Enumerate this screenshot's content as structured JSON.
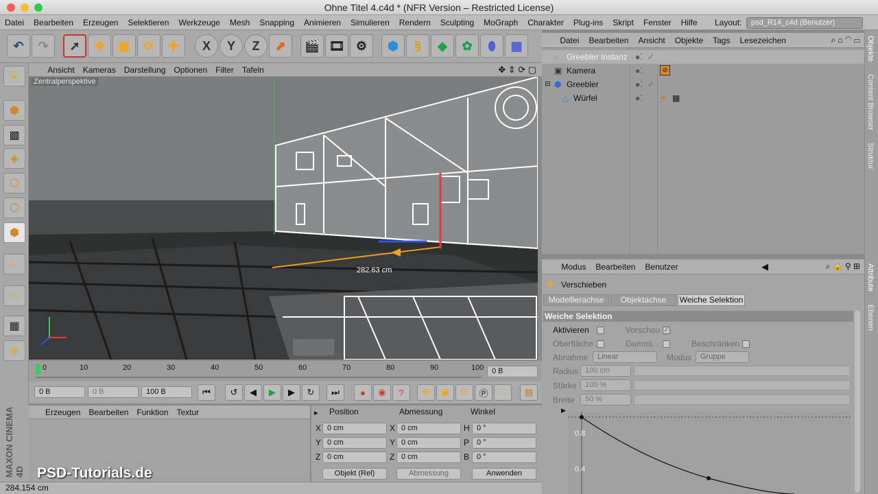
{
  "window": {
    "title": "Ohne Titel 4.c4d * (NFR Version – Restricted License)"
  },
  "menubar": {
    "items": [
      "Datei",
      "Bearbeiten",
      "Erzeugen",
      "Selektieren",
      "Werkzeuge",
      "Mesh",
      "Snapping",
      "Animieren",
      "Simulieren",
      "Rendern",
      "Sculpting",
      "MoGraph",
      "Charakter",
      "Plug-ins",
      "Skript",
      "Fenster",
      "Hilfe"
    ],
    "layout_label": "Layout:",
    "layout_value": "psd_R14_c4d (Benutzer)"
  },
  "viewport": {
    "menu": [
      "Ansicht",
      "Kameras",
      "Darstellung",
      "Optionen",
      "Filter",
      "Tafeln"
    ],
    "label": "Zentralperspektive",
    "measure": "282.63 cm"
  },
  "timeline": {
    "ticks": [
      "0",
      "10",
      "20",
      "30",
      "40",
      "50",
      "60",
      "70",
      "80",
      "90",
      "100"
    ],
    "current_frame": "0 B"
  },
  "transport": {
    "start": "0 B",
    "preview_start": "0 B",
    "end": "100 B"
  },
  "materials": {
    "menu": [
      "Erzeugen",
      "Bearbeiten",
      "Funktion",
      "Textur"
    ]
  },
  "coordinates": {
    "headers": [
      "Position",
      "Abmessung",
      "Winkel"
    ],
    "rows": [
      {
        "a": "X",
        "pos": "0 cm",
        "b": "X",
        "size": "0 cm",
        "c": "H",
        "rot": "0 °"
      },
      {
        "a": "Y",
        "pos": "0 cm",
        "b": "Y",
        "size": "0 cm",
        "c": "P",
        "rot": "0 °"
      },
      {
        "a": "Z",
        "pos": "0 cm",
        "b": "Z",
        "size": "0 cm",
        "c": "B",
        "rot": "0 °"
      }
    ],
    "mode": "Objekt (Rel)",
    "size_mode": "Abmessung",
    "apply": "Anwenden"
  },
  "status": {
    "text": "284.154 cm"
  },
  "watermark": {
    "text": "PSD-Tutorials.de",
    "brand": "MAXON CINEMA 4D"
  },
  "object_manager": {
    "menu": [
      "Datei",
      "Bearbeiten",
      "Ansicht",
      "Objekte",
      "Tags",
      "Lesezeichen"
    ],
    "objects": [
      {
        "name": "Greebler Instanz",
        "highlight": true
      },
      {
        "name": "Kamera",
        "highlight": false
      },
      {
        "name": "Greebler",
        "highlight": false
      },
      {
        "name": "Würfel",
        "highlight": false
      }
    ]
  },
  "attributes": {
    "menu": [
      "Modus",
      "Bearbeiten",
      "Benutzer"
    ],
    "tool": "Verschieben",
    "tabs": [
      "Modellierachse",
      "Objektachse",
      "Weiche Selektion"
    ],
    "section": "Weiche Selektion",
    "activate": "Aktivieren",
    "preview": "Vorschau",
    "surface": "Oberfläche",
    "rubber": "Gummi. .",
    "restrict": "Beschränken",
    "falloff_label": "Abnahme",
    "falloff_value": "Linear",
    "mode_label": "Modus",
    "mode_value": "Gruppe",
    "radius_label": "Radius",
    "radius_value": "100 cm",
    "strength_label": "Stärke",
    "strength_value": "100 %",
    "width_label": "Breite",
    "width_value": "50 %",
    "graph_y1": "0.8",
    "graph_y2": "0.4"
  },
  "side_tabs": [
    "Objekte",
    "Content Browser",
    "Struktur",
    "Attribute",
    "Ebenen"
  ]
}
